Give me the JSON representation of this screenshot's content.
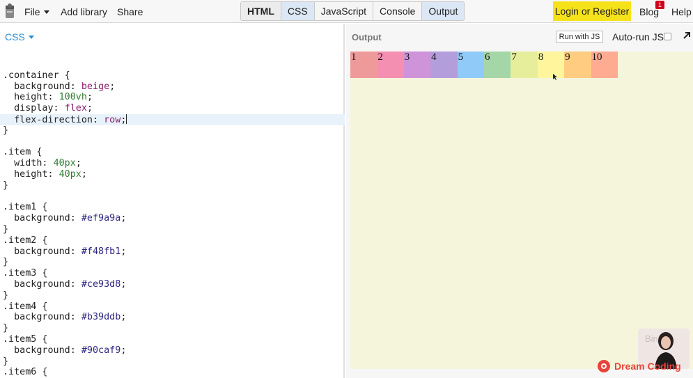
{
  "topbar": {
    "menu": [
      {
        "label": "File",
        "has_caret": true
      },
      {
        "label": "Add library"
      },
      {
        "label": "Share"
      }
    ],
    "tabs": [
      {
        "label": "HTML",
        "state": "bold"
      },
      {
        "label": "CSS",
        "state": "active"
      },
      {
        "label": "JavaScript",
        "state": "normal"
      },
      {
        "label": "Console",
        "state": "normal"
      },
      {
        "label": "Output",
        "state": "active"
      }
    ],
    "login_label": "Login or Register",
    "blog_label": "Blog",
    "blog_badge": "1",
    "help_label": "Help"
  },
  "editor": {
    "language_label": "CSS",
    "lines": [
      [],
      [
        {
          "t": ".container {",
          "c": "sel"
        }
      ],
      [
        {
          "t": "  background: ",
          "c": "prop"
        },
        {
          "t": "beige",
          "c": "val"
        },
        {
          "t": ";",
          "c": "prop"
        }
      ],
      [
        {
          "t": "  height: ",
          "c": "prop"
        },
        {
          "t": "100vh",
          "c": "num"
        },
        {
          "t": ";",
          "c": "prop"
        }
      ],
      [
        {
          "t": "  display: ",
          "c": "prop"
        },
        {
          "t": "flex",
          "c": "val"
        },
        {
          "t": ";",
          "c": "prop"
        }
      ],
      [
        {
          "t": "  flex-direction: ",
          "c": "prop"
        },
        {
          "t": "row",
          "c": "val"
        },
        {
          "t": ";",
          "c": "prop"
        }
      ],
      [
        {
          "t": "}",
          "c": "sel"
        }
      ],
      [],
      [
        {
          "t": ".item {",
          "c": "sel"
        }
      ],
      [
        {
          "t": "  width: ",
          "c": "prop"
        },
        {
          "t": "40px",
          "c": "num"
        },
        {
          "t": ";",
          "c": "prop"
        }
      ],
      [
        {
          "t": "  height: ",
          "c": "prop"
        },
        {
          "t": "40px",
          "c": "num"
        },
        {
          "t": ";",
          "c": "prop"
        }
      ],
      [
        {
          "t": "}",
          "c": "sel"
        }
      ],
      [],
      [
        {
          "t": ".item1 {",
          "c": "sel"
        }
      ],
      [
        {
          "t": "  background: ",
          "c": "prop"
        },
        {
          "t": "#ef9a9a",
          "c": "hex"
        },
        {
          "t": ";",
          "c": "prop"
        }
      ],
      [
        {
          "t": "}",
          "c": "sel"
        }
      ],
      [
        {
          "t": ".item2 {",
          "c": "sel"
        }
      ],
      [
        {
          "t": "  background: ",
          "c": "prop"
        },
        {
          "t": "#f48fb1",
          "c": "hex"
        },
        {
          "t": ";",
          "c": "prop"
        }
      ],
      [
        {
          "t": "}",
          "c": "sel"
        }
      ],
      [
        {
          "t": ".item3 {",
          "c": "sel"
        }
      ],
      [
        {
          "t": "  background: ",
          "c": "prop"
        },
        {
          "t": "#ce93d8",
          "c": "hex"
        },
        {
          "t": ";",
          "c": "prop"
        }
      ],
      [
        {
          "t": "}",
          "c": "sel"
        }
      ],
      [
        {
          "t": ".item4 {",
          "c": "sel"
        }
      ],
      [
        {
          "t": "  background: ",
          "c": "prop"
        },
        {
          "t": "#b39ddb",
          "c": "hex"
        },
        {
          "t": ";",
          "c": "prop"
        }
      ],
      [
        {
          "t": "}",
          "c": "sel"
        }
      ],
      [
        {
          "t": ".item5 {",
          "c": "sel"
        }
      ],
      [
        {
          "t": "  background: ",
          "c": "prop"
        },
        {
          "t": "#90caf9",
          "c": "hex"
        },
        {
          "t": ";",
          "c": "prop"
        }
      ],
      [
        {
          "t": "}",
          "c": "sel"
        }
      ],
      [
        {
          "t": ".item6 {",
          "c": "sel"
        }
      ]
    ],
    "highlight_line": 5
  },
  "output": {
    "title": "Output",
    "run_label": "Run with JS",
    "autorun_label": "Auto-run JS",
    "autorun_checked": false,
    "container_color": "#f5f5dc",
    "items": [
      {
        "label": "1",
        "color": "#ef9a9a"
      },
      {
        "label": "2",
        "color": "#f48fb1"
      },
      {
        "label": "3",
        "color": "#ce93d8"
      },
      {
        "label": "4",
        "color": "#b39ddb"
      },
      {
        "label": "5",
        "color": "#90caf9"
      },
      {
        "label": "6",
        "color": "#a5d6a7"
      },
      {
        "label": "7",
        "color": "#e6ee9c"
      },
      {
        "label": "8",
        "color": "#fff59d"
      },
      {
        "label": "9",
        "color": "#ffcc80"
      },
      {
        "label": "10",
        "color": "#ffab91"
      }
    ]
  },
  "watermark": {
    "brand": "Dream Coding",
    "overlay_text": "Binfo"
  }
}
